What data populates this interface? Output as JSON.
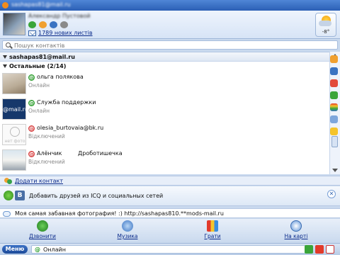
{
  "window": {
    "title": "sashapas81@mail.ru"
  },
  "profile": {
    "name": "Александр Пустовой",
    "mail_count": "1789 нових листів"
  },
  "weather": {
    "temp": "-8°"
  },
  "search": {
    "placeholder": "Пошук контактів"
  },
  "groups": {
    "account": "sashapas81@mail.ru",
    "others": "Остальные (2/14)"
  },
  "contacts": [
    {
      "name": "ольга полякова",
      "status": "Онлайн"
    },
    {
      "name": "Служба поддержки",
      "status": "Онлайн"
    },
    {
      "name": "olesia_burtovaia@bk.ru",
      "status": "Відключений",
      "avatar_text": "нет фото"
    },
    {
      "name": "Алёнчик",
      "extra": "Дроботишечка",
      "status": "Відключений"
    }
  ],
  "support_logo": "@mail.ru",
  "actions": {
    "add_contact": "Додати контакт"
  },
  "promo": {
    "text": "Добавить друзей из ICQ и социальных сетей",
    "vk_letter": "B"
  },
  "status_message": "Моя самая забавная фотография! :) http://sashapas810.**mods-mail.ru",
  "toolbar": [
    {
      "label": "Дзвонити",
      "icon": "phone-icon"
    },
    {
      "label": "Музика",
      "icon": "music-icon"
    },
    {
      "label": "Грати",
      "icon": "games-icon"
    },
    {
      "label": "На карті",
      "icon": "compass-icon"
    }
  ],
  "bottom": {
    "menu_label": "Меню",
    "status": "Онлайн"
  },
  "colors": {
    "accent": "#2b5fb5",
    "online": "#2a9c2a",
    "offline": "#d63a3a",
    "link": "#0a2a8a"
  }
}
